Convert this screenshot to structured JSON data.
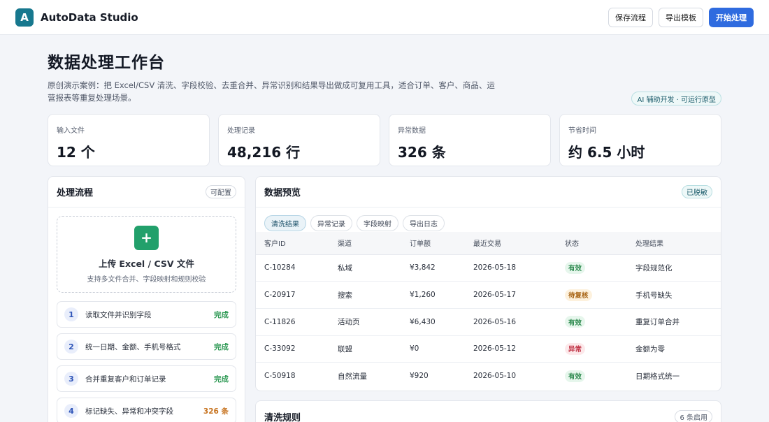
{
  "app": {
    "logo_letter": "A",
    "title": "AutoData Studio"
  },
  "toolbar": {
    "save_label": "保存流程",
    "export_label": "导出模板",
    "start_label": "开始处理"
  },
  "colors": {
    "brand": "#17788e",
    "primary": "#2f6bdf",
    "success": "#2f9a55",
    "warning": "#c7731f",
    "danger": "#c2384a"
  },
  "page": {
    "title": "数据处理工作台",
    "description": "原创演示案例：把 Excel/CSV 清洗、字段校验、去重合并、异常识别和结果导出做成可复用工具，适合订单、客户、商品、运营报表等重复处理场景。",
    "badge": "AI 辅助开发 · 可运行原型"
  },
  "stats": [
    {
      "label": "输入文件",
      "value": "12 个"
    },
    {
      "label": "处理记录",
      "value": "48,216 行"
    },
    {
      "label": "异常数据",
      "value": "326 条"
    },
    {
      "label": "节省时间",
      "value": "约 6.5 小时"
    }
  ],
  "workflow": {
    "title": "处理流程",
    "tag": "可配置",
    "upload_icon": "plus-icon",
    "upload_title": "上传 Excel / CSV 文件",
    "upload_subtitle": "支持多文件合并、字段映射和规则校验",
    "steps": [
      {
        "num": "1",
        "label": "读取文件并识别字段",
        "status": "完成"
      },
      {
        "num": "2",
        "label": "统一日期、金额、手机号格式",
        "status": "完成"
      },
      {
        "num": "3",
        "label": "合并重复客户和订单记录",
        "status": "完成"
      },
      {
        "num": "4",
        "label": "标记缺失、异常和冲突字段",
        "status": "326 条"
      }
    ]
  },
  "preview": {
    "title": "数据预览",
    "tag": "已脱敏",
    "tabs": [
      "清洗结果",
      "异常记录",
      "字段映射",
      "导出日志"
    ],
    "columns": [
      "客户ID",
      "渠道",
      "订单额",
      "最近交易",
      "状态",
      "处理结果"
    ],
    "rows": [
      {
        "id": "C-10284",
        "channel": "私域",
        "amount": "¥3,842",
        "date": "2026-05-18",
        "status": "有效",
        "result": "字段规范化"
      },
      {
        "id": "C-20917",
        "channel": "搜索",
        "amount": "¥1,260",
        "date": "2026-05-17",
        "status": "待复核",
        "result": "手机号缺失"
      },
      {
        "id": "C-11826",
        "channel": "活动页",
        "amount": "¥6,430",
        "date": "2026-05-16",
        "status": "有效",
        "result": "重复订单合并"
      },
      {
        "id": "C-33092",
        "channel": "联盟",
        "amount": "¥0",
        "date": "2026-05-12",
        "status": "异常",
        "result": "金额为零"
      },
      {
        "id": "C-50918",
        "channel": "自然流量",
        "amount": "¥920",
        "date": "2026-05-10",
        "status": "有效",
        "result": "日期格式统一"
      }
    ]
  },
  "rules": {
    "title": "清洗规则",
    "tag": "6 条启用"
  }
}
